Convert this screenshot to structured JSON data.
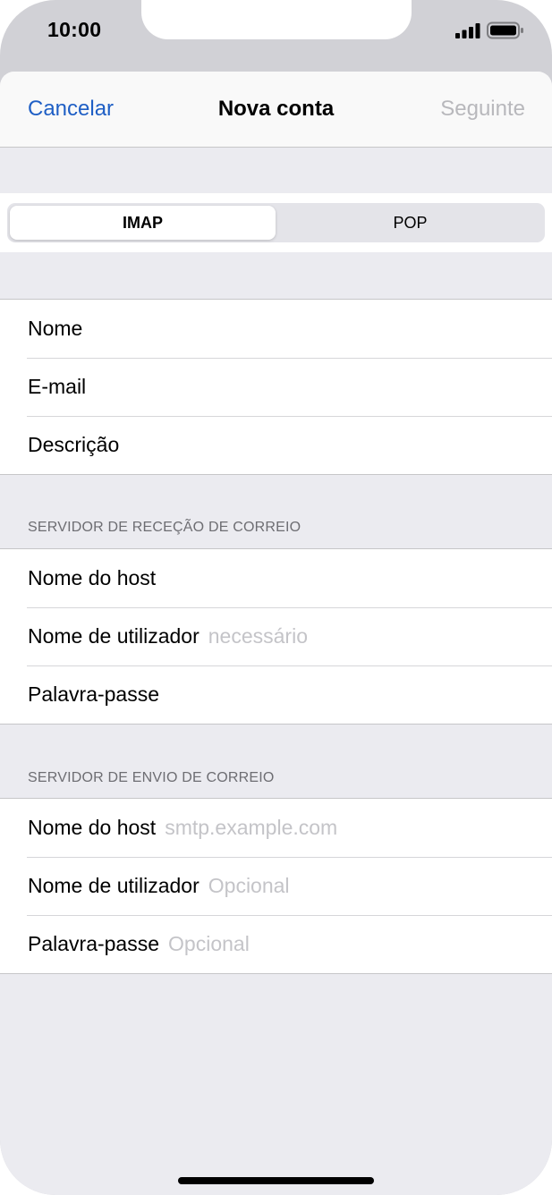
{
  "status_bar": {
    "time": "10:00",
    "signal_icon": "cellular-signal-icon",
    "battery_icon": "battery-icon"
  },
  "navbar": {
    "cancel_label": "Cancelar",
    "title": "Nova conta",
    "next_label": "Seguinte"
  },
  "segmented": {
    "options": [
      "IMAP",
      "POP"
    ],
    "selected": "IMAP"
  },
  "account": {
    "rows": [
      {
        "label": "Nome",
        "value": ""
      },
      {
        "label": "E-mail",
        "value": ""
      },
      {
        "label": "Descrição",
        "value": ""
      }
    ]
  },
  "incoming": {
    "header": "SERVIDOR DE RECEÇÃO DE CORREIO",
    "rows": [
      {
        "label": "Nome do host",
        "value": ""
      },
      {
        "label": "Nome de utilizador",
        "value": "necessário"
      },
      {
        "label": "Palavra-passe",
        "value": ""
      }
    ]
  },
  "outgoing": {
    "header": "SERVIDOR DE ENVIO DE CORREIO",
    "rows": [
      {
        "label": "Nome do host",
        "value": "smtp.example.com"
      },
      {
        "label": "Nome de utilizador",
        "value": "Opcional"
      },
      {
        "label": "Palavra-passe",
        "value": "Opcional"
      }
    ]
  },
  "colors": {
    "accent": "#1f5fc5",
    "disabled": "#b8b8bc",
    "placeholder": "#c4c4c8",
    "grouped_background": "#ebebf0"
  }
}
